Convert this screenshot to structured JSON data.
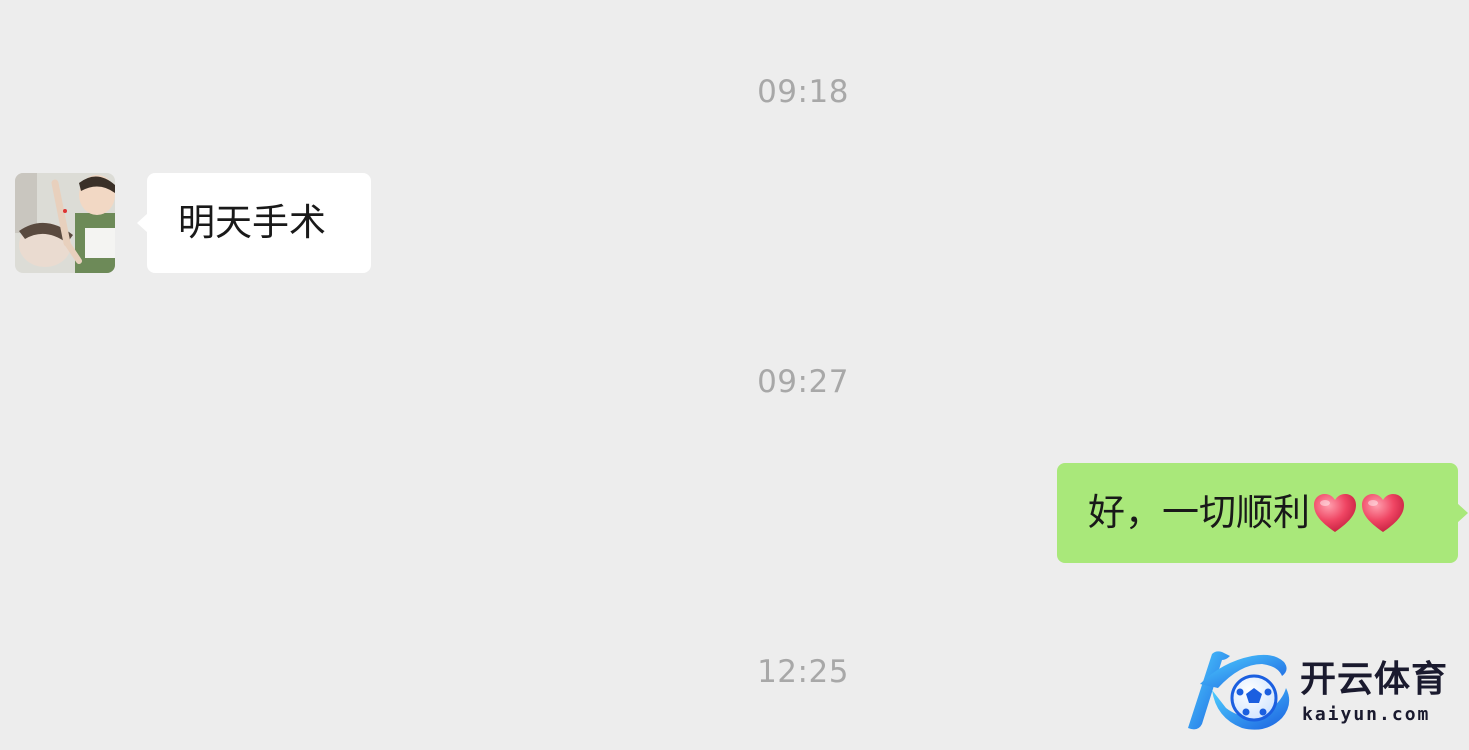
{
  "chat": {
    "messages": [
      {
        "type": "timestamp",
        "text": "09:18"
      },
      {
        "type": "incoming",
        "text": "明天手术"
      },
      {
        "type": "timestamp",
        "text": "09:27"
      },
      {
        "type": "outgoing",
        "text": "好，一切顺利",
        "emoji": [
          "red-heart",
          "red-heart"
        ]
      },
      {
        "type": "timestamp",
        "text": "12:25"
      }
    ]
  },
  "watermark": {
    "brand_cn": "开云体育",
    "brand_en": "kaiyun.com"
  },
  "colors": {
    "background": "#ededed",
    "incoming_bubble": "#ffffff",
    "outgoing_bubble": "#a9e87a",
    "timestamp_text": "#a8a8a8",
    "message_text": "#191919"
  },
  "icons": {
    "avatar": "user-avatar-photo",
    "heart": "red-heart-emoji",
    "logo": "kaiyun-k-football-logo"
  }
}
